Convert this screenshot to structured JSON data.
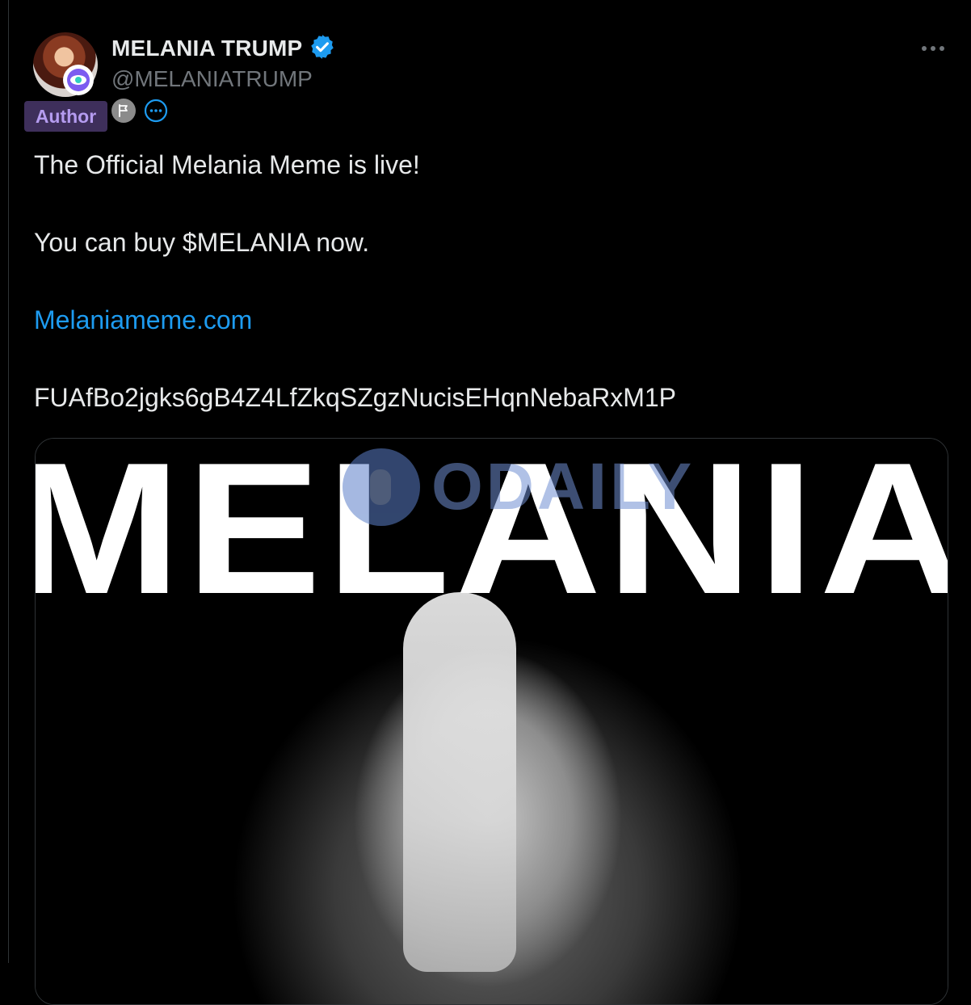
{
  "author": {
    "display_name": "MELANIA TRUMP",
    "handle": "@MELANIATRUMP",
    "author_tag": "Author",
    "verified": true
  },
  "icons": {
    "verified": "verified-badge-icon",
    "more": "more-options-icon",
    "flag": "flag-icon",
    "extra": "dots-circle-icon",
    "avatar_badge": "eye-badge-icon"
  },
  "tweet": {
    "line1": "The Official Melania Meme is live!",
    "line2": "You can buy $MELANIA now.",
    "link": "Melaniameme.com",
    "address": "FUAfBo2jgks6gB4Z4LfZkqSZgzNucisEHqnNebaRxM1P"
  },
  "media": {
    "title": "MELANIA",
    "watermark": "ODAILY"
  },
  "colors": {
    "background": "#000000",
    "link": "#1d9bf0",
    "verified": "#1d9bf0",
    "author_badge_bg": "#3e2f5b",
    "author_badge_text": "#b59cf0",
    "handle": "#71767b"
  }
}
